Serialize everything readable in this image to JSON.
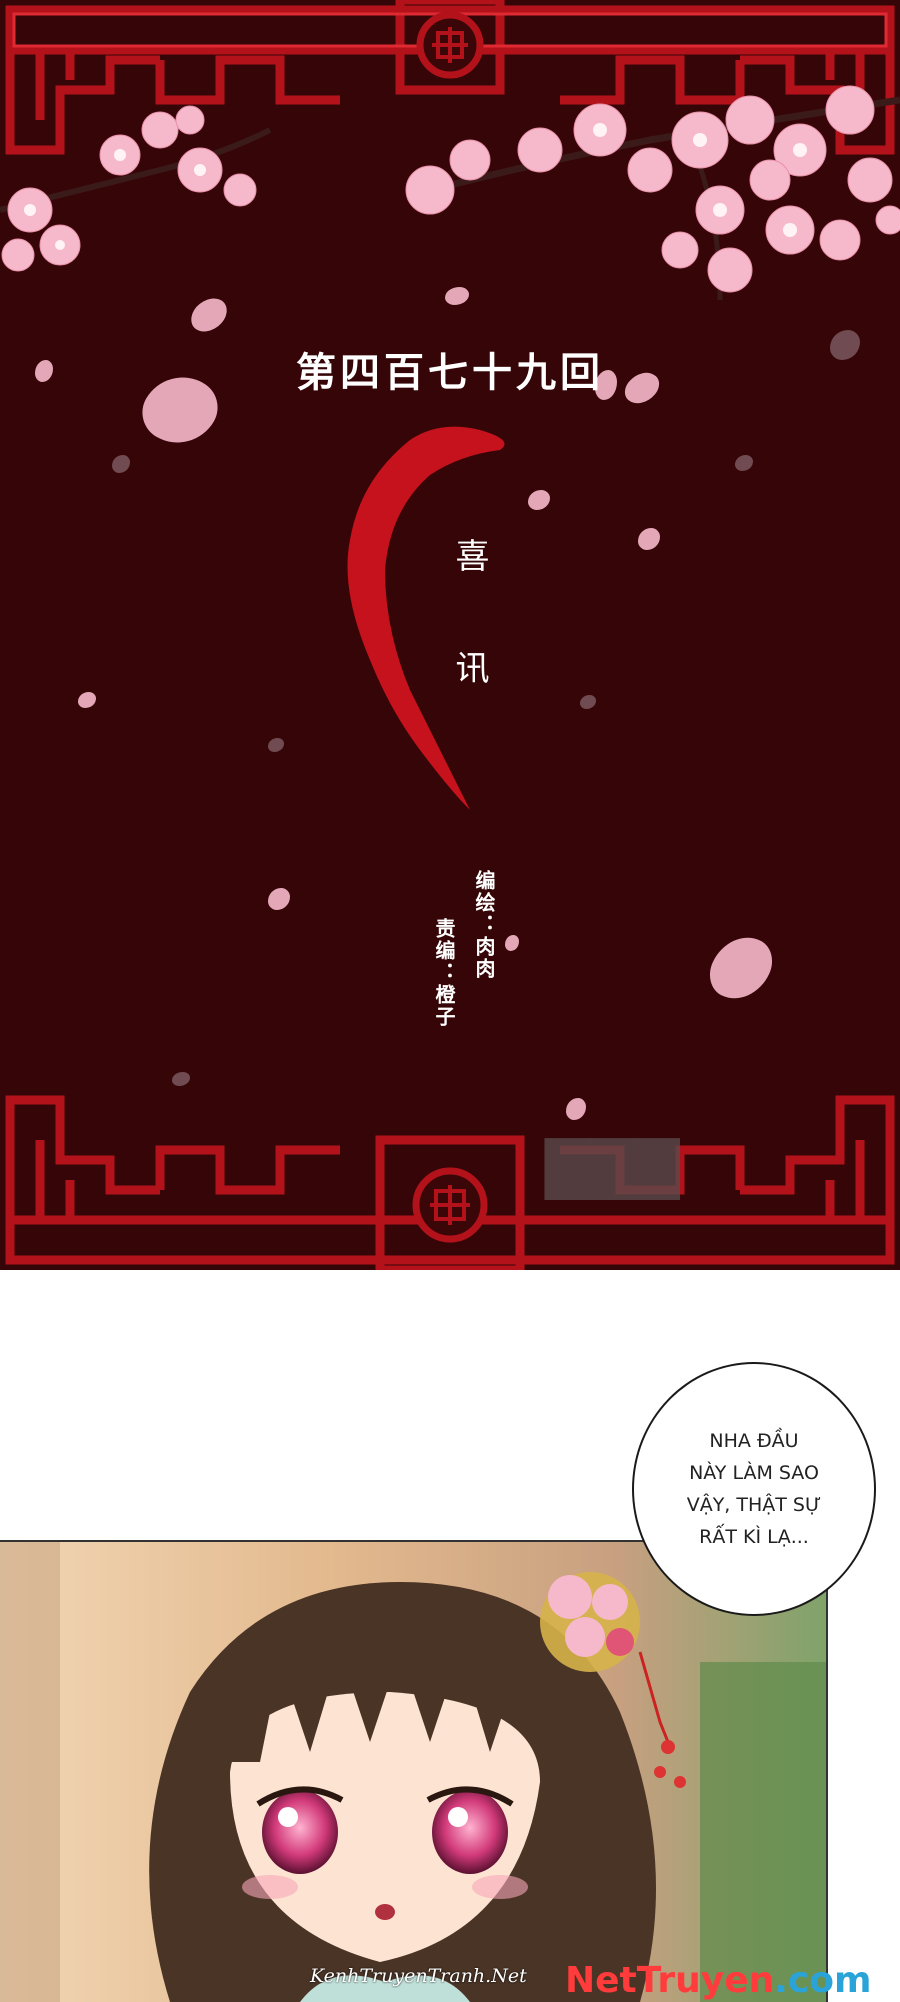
{
  "title_panel": {
    "chapter_title": "第四百七十九回",
    "chapter_name_1": "喜",
    "chapter_name_2": "讯",
    "credit_artist": "编绘：肉肉",
    "credit_editor": "责编：橙子",
    "background_color": "#360507",
    "frame_color": "#b3121b",
    "blossom_color": "#f6b9cb",
    "watermark_icon": "publisher-logo-icon"
  },
  "speech_bubble": {
    "lines": [
      "NHA ĐẦU",
      "NÀY LÀM SAO",
      "VẬY, THẬT SỰ",
      "RẤT KÌ LẠ..."
    ]
  },
  "character_panel": {
    "illustration": "girl-with-hairpin-illustration"
  },
  "footer": {
    "credit": "KenhTruyenTranh.Net",
    "site_logo_part1": "NetTruyen",
    "site_logo_part2": ".com"
  }
}
